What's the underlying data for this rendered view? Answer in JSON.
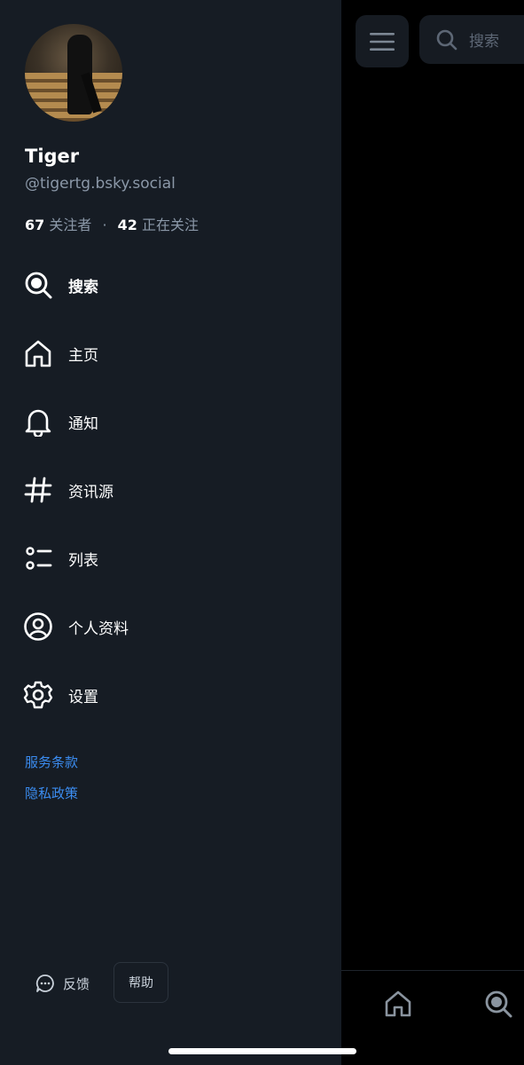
{
  "profile": {
    "display_name": "Tiger",
    "handle": "@tigertg.bsky.social",
    "followers_count": "67",
    "followers_label": "关注者",
    "separator": "·",
    "following_count": "42",
    "following_label": "正在关注"
  },
  "nav": {
    "items": [
      {
        "label": "搜索",
        "icon": "search-icon"
      },
      {
        "label": "主页",
        "icon": "home-icon"
      },
      {
        "label": "通知",
        "icon": "bell-icon"
      },
      {
        "label": "资讯源",
        "icon": "hashtag-icon"
      },
      {
        "label": "列表",
        "icon": "list-icon"
      },
      {
        "label": "个人资料",
        "icon": "user-circle-icon"
      },
      {
        "label": "设置",
        "icon": "gear-icon"
      }
    ]
  },
  "links": {
    "terms": "服务条款",
    "privacy": "隐私政策"
  },
  "footer": {
    "feedback_label": "反馈",
    "help_label": "帮助"
  },
  "background": {
    "search_placeholder": "搜索"
  },
  "colors": {
    "drawer_bg": "#161c24",
    "accent_link": "#3b8cf0",
    "text_primary": "#ffffff",
    "text_secondary": "#8b98a8"
  }
}
